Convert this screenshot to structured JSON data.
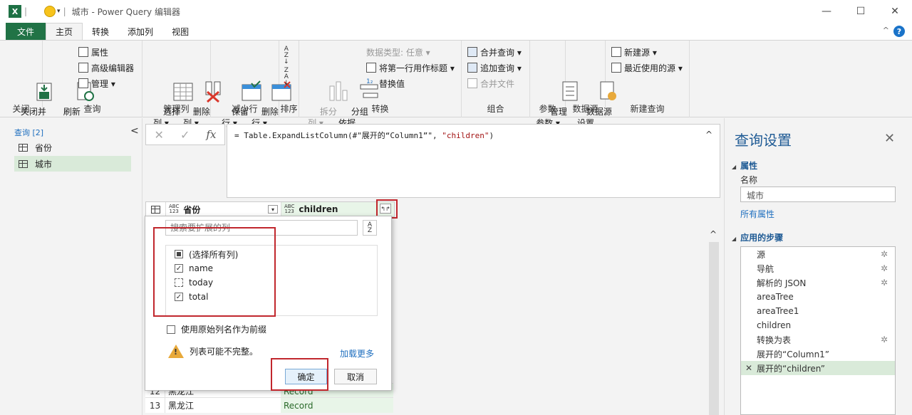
{
  "window": {
    "title": "城市 - Power Query 编辑器",
    "app_icon": "X",
    "separator": "|",
    "qat_arrow": "▾",
    "controls": [
      "—",
      "☐",
      "✕"
    ]
  },
  "menu": {
    "tabs": [
      "文件",
      "主页",
      "转换",
      "添加列",
      "视图"
    ],
    "collapse": "^",
    "help": "?"
  },
  "ribbon": {
    "close_group": {
      "big": "关闭并\n上载 ▾",
      "label": "关闭"
    },
    "query_group": {
      "refresh": "刷新\n预览 ▾",
      "properties": "属性",
      "advanced_editor": "高级编辑器",
      "manage": "管理 ▾",
      "label": "查询"
    },
    "manage_cols": {
      "choose": "选择\n列 ▾",
      "remove": "删除\n列 ▾",
      "label": "管理列"
    },
    "reduce_rows": {
      "keep": "保留\n行 ▾",
      "remove": "删除\n行 ▾",
      "label": "减少行"
    },
    "sort": {
      "label": "排序"
    },
    "transform": {
      "split": "拆分\n列 ▾",
      "group": "分组\n依据",
      "datatype": "数据类型: 任意 ▾",
      "first_row": "将第一行用作标题 ▾",
      "replace": "替换值",
      "label": "转换"
    },
    "combine": {
      "merge": "合并查询 ▾",
      "append": "追加查询 ▾",
      "combine_files": "合并文件",
      "label": "组合"
    },
    "params": {
      "manage": "管理\n参数 ▾",
      "label": "参数"
    },
    "datasource": {
      "settings": "数据源\n设置",
      "label": "数据源"
    },
    "newquery": {
      "new_source": "新建源 ▾",
      "recent": "最近使用的源 ▾",
      "label": "新建查询"
    }
  },
  "queries": {
    "header": "查询 [2]",
    "collapse": "<",
    "items": [
      "省份",
      "城市"
    ]
  },
  "formula": {
    "cancel": "✕",
    "accept": "✓",
    "fx": "fx",
    "prefix": "= Table.ExpandListColumn(#\"展开的“Column1”\", ",
    "arg": "\"children\"",
    "suffix": ")",
    "expand": "^"
  },
  "grid": {
    "col1": {
      "type": "ABC\n123",
      "name": "省份"
    },
    "col2": {
      "type": "ABC\n123",
      "name": "children"
    },
    "dropdown": "▾",
    "expand_icon": "↰↱",
    "rows": [
      {
        "num": "12",
        "name": "黑龙江",
        "value": "Record"
      },
      {
        "num": "13",
        "name": "黑龙江",
        "value": "Record"
      }
    ]
  },
  "expand_popup": {
    "search_placeholder": "搜索要扩展的列",
    "sort": "A\nZ",
    "select_all": "(选择所有列)",
    "columns": [
      {
        "label": "name",
        "checked": true
      },
      {
        "label": "today",
        "checked": false
      },
      {
        "label": "total",
        "checked": true
      }
    ],
    "use_prefix": "使用原始列名作为前缀",
    "warning": "列表可能不完整。",
    "warning_icon": "!",
    "load_more": "加载更多",
    "ok": "确定",
    "cancel": "取消"
  },
  "settings": {
    "title": "查询设置",
    "close": "✕",
    "properties_header": "属性",
    "name_label": "名称",
    "name_value": "城市",
    "all_properties": "所有属性",
    "steps_header": "应用的步骤",
    "collapse_arrow": "◢",
    "steps": [
      {
        "label": "源",
        "gear": true
      },
      {
        "label": "导航",
        "gear": true
      },
      {
        "label": "解析的 JSON",
        "gear": true
      },
      {
        "label": "areaTree",
        "gear": false
      },
      {
        "label": "areaTree1",
        "gear": false
      },
      {
        "label": "children",
        "gear": false
      },
      {
        "label": "转换为表",
        "gear": true
      },
      {
        "label": "展开的“Column1”",
        "gear": false
      },
      {
        "label": "展开的“children”",
        "gear": false,
        "selected": true
      }
    ],
    "step_delete": "✕",
    "gear_icon": "✲"
  },
  "scroll": {
    "up": "^"
  },
  "colors": {
    "excel_green": "#217346",
    "accent_blue": "#1e5a94",
    "highlight_red": "#c1272d",
    "selected_green": "#d9ead9"
  }
}
